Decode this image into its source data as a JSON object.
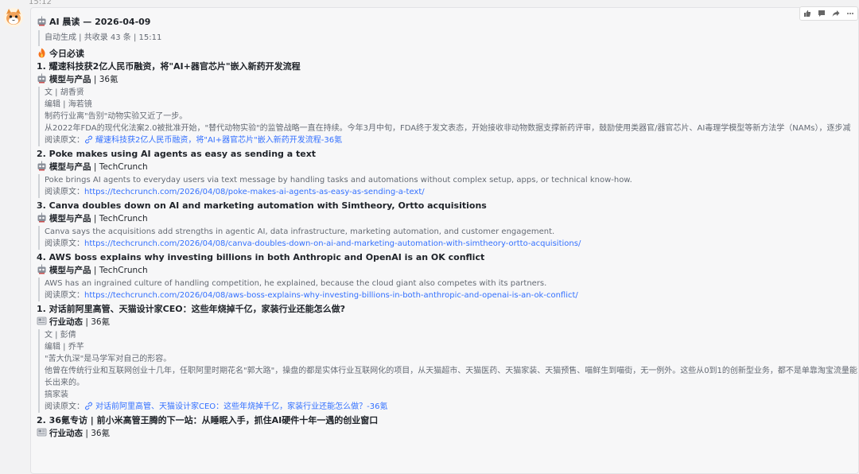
{
  "timestamp": "15:12",
  "header": {
    "title": "AI 晨读 — 2026-04-09",
    "meta": "自动生成 | 共收录 43 条 | 15:11"
  },
  "section": {
    "label": "今日必读"
  },
  "items": [
    {
      "title": "1. 耀速科技获2亿人民币融资，将\"AI+器官芯片\"嵌入新药开发流程",
      "category": "模型与产品",
      "category_icon": "robot-icon",
      "source": "| 36氪",
      "lines": [
        "文 | 胡香贤",
        "编辑 | 海若镜",
        "制药行业离\"告别\"动物实验又近了一步。",
        "从2022年FDA的现代化法案2.0被批准开始，\"替代动物实验\"的监管战略一直在持续。今年3月中旬，FDA终于发文表态，开始接收非动物数据支撑新药评审，鼓励使用类器官/器官芯片、AI毒理学模型等新方法学（NAMs），逐步减"
      ],
      "read_label": "阅读原文：",
      "link_text": "耀速科技获2亿人民币融资，将\"AI+器官芯片\"嵌入新药开发流程-36氪",
      "link_icon": "link-icon"
    },
    {
      "title": "2. Poke makes using AI agents as easy as sending a text",
      "category": "模型与产品",
      "category_icon": "robot-icon",
      "source": "| TechCrunch",
      "lines": [
        "Poke brings AI agents to everyday users via text message by handling tasks and automations without complex setup, apps, or technical know-how."
      ],
      "read_label": "阅读原文：",
      "link_text": "https://techcrunch.com/2026/04/08/poke-makes-ai-agents-as-easy-as-sending-a-text/"
    },
    {
      "title": "3. Canva doubles down on AI and marketing automation with Simtheory, Ortto acquisitions",
      "category": "模型与产品",
      "category_icon": "robot-icon",
      "source": "| TechCrunch",
      "lines": [
        "Canva says the acquisitions add strengths in agentic AI, data infrastructure, marketing automation, and customer engagement."
      ],
      "read_label": "阅读原文：",
      "link_text": "https://techcrunch.com/2026/04/08/canva-doubles-down-on-ai-and-marketing-automation-with-simtheory-ortto-acquisitions/"
    },
    {
      "title": "4. AWS boss explains why investing billions in both Anthropic and OpenAI is an OK conflict",
      "category": "模型与产品",
      "category_icon": "robot-icon",
      "source": "| TechCrunch",
      "lines": [
        "AWS has an ingrained culture of handling competition, he explained, because the cloud giant also competes with its partners."
      ],
      "read_label": "阅读原文：",
      "link_text": "https://techcrunch.com/2026/04/08/aws-boss-explains-why-investing-billions-in-both-anthropic-and-openai-is-an-ok-conflict/"
    },
    {
      "title": "1. 对话前阿里高管、天猫设计家CEO：这些年烧掉千亿，家装行业还能怎么做?",
      "category": "行业动态",
      "category_icon": "newspaper-icon",
      "source": "| 36氪",
      "lines": [
        "文 | 彭倩",
        "编辑 | 乔芊",
        "\"苦大仇深\"是马学军对自己的形容。",
        "他曾在传统行业和互联网创业十几年，任职阿里时期花名\"郭大路\"，操盘的都是实体行业互联网化的项目，从天猫超市、天猫医药、天猫家装、天猫预售、喵鲜生到喵街，无一例外。这些从0到1的创新型业务，都不是单靠淘宝流量能长出来的。",
        "搞家装"
      ],
      "read_label": "阅读原文：",
      "link_text": "对话前阿里高管、天猫设计家CEO：这些年烧掉千亿，家装行业还能怎么做？-36氪",
      "link_icon": "link-icon"
    },
    {
      "title": "2. 36氪专访 | 前小米高管王腾的下一站：从睡眠入手，抓住AI硬件十年一遇的创业窗口",
      "category": "行业动态",
      "category_icon": "newspaper-icon",
      "source": "| 36氪"
    }
  ],
  "toolbar": [
    "thumbs-up-icon",
    "comment-icon",
    "forward-icon",
    "more-icon"
  ],
  "colors": {
    "link": "#3370ff",
    "quote_border": "#cfd2d6",
    "fire": "#f5721c"
  }
}
